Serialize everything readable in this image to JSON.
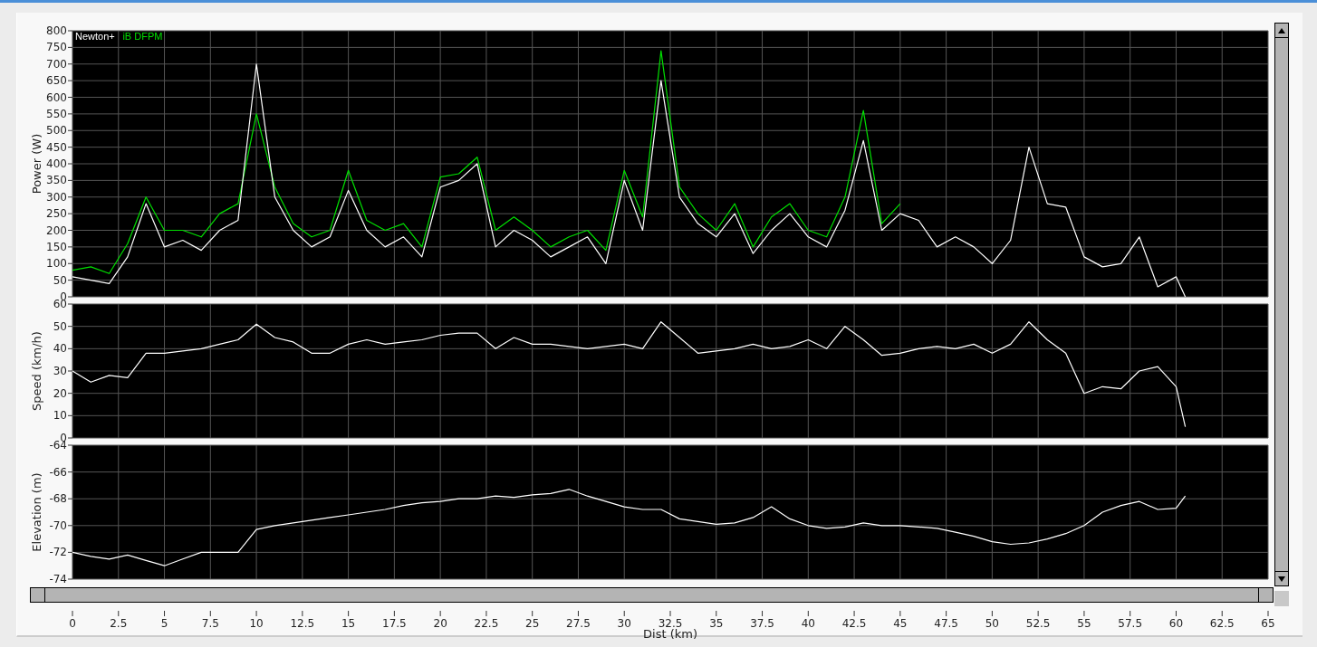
{
  "charts": [
    {
      "chart_data": {
        "type": "line",
        "grid": true,
        "ylabel": "Power (W)",
        "xlim": [
          0,
          65
        ],
        "ylim": [
          0,
          800
        ],
        "yticks": [
          0,
          50,
          100,
          150,
          200,
          250,
          300,
          350,
          400,
          450,
          500,
          550,
          600,
          650,
          700,
          750,
          800
        ],
        "x": [
          0,
          1,
          2,
          3,
          4,
          5,
          6,
          7,
          8,
          9,
          10,
          11,
          12,
          13,
          14,
          15,
          16,
          17,
          18,
          19,
          20,
          21,
          22,
          23,
          24,
          25,
          26,
          27,
          28,
          29,
          30,
          31,
          32,
          33,
          34,
          35,
          36,
          37,
          38,
          39,
          40,
          41,
          42,
          43,
          44,
          45,
          46,
          47,
          48,
          49,
          50,
          51,
          52,
          53,
          54,
          55,
          56,
          57,
          58,
          59,
          60,
          60.5
        ],
        "series": [
          {
            "name": "iB DFPM",
            "color": "#00e000",
            "values": [
              80,
              90,
              70,
              160,
              300,
              200,
              200,
              180,
              250,
              280,
              550,
              330,
              220,
              180,
              200,
              380,
              230,
              200,
              220,
              150,
              360,
              370,
              420,
              200,
              240,
              200,
              150,
              180,
              200,
              140,
              380,
              240,
              740,
              330,
              250,
              200,
              280,
              150,
              240,
              280,
              200,
              180,
              300,
              560,
              220,
              280,
              null,
              null,
              null,
              null,
              null,
              null,
              null,
              null,
              null,
              null,
              null,
              null,
              null,
              null,
              null,
              null
            ]
          },
          {
            "name": "Newton+",
            "color": "#ffffff",
            "values": [
              60,
              50,
              40,
              120,
              280,
              150,
              170,
              140,
              200,
              230,
              700,
              300,
              200,
              150,
              180,
              320,
              200,
              150,
              180,
              120,
              330,
              350,
              400,
              150,
              200,
              170,
              120,
              150,
              180,
              100,
              350,
              200,
              650,
              300,
              220,
              180,
              250,
              130,
              200,
              250,
              180,
              150,
              260,
              470,
              200,
              250,
              230,
              150,
              180,
              150,
              100,
              170,
              450,
              280,
              270,
              120,
              90,
              100,
              180,
              30,
              60,
              0
            ]
          }
        ]
      }
    },
    {
      "chart_data": {
        "type": "line",
        "grid": true,
        "ylabel": "Speed (km/h)",
        "xlim": [
          0,
          65
        ],
        "ylim": [
          0,
          60
        ],
        "yticks": [
          0,
          10,
          20,
          30,
          40,
          50,
          60
        ],
        "x": [
          0,
          1,
          2,
          3,
          4,
          5,
          6,
          7,
          8,
          9,
          10,
          11,
          12,
          13,
          14,
          15,
          16,
          17,
          18,
          19,
          20,
          21,
          22,
          23,
          24,
          25,
          26,
          27,
          28,
          29,
          30,
          31,
          32,
          33,
          34,
          35,
          36,
          37,
          38,
          39,
          40,
          41,
          42,
          43,
          44,
          45,
          46,
          47,
          48,
          49,
          50,
          51,
          52,
          53,
          54,
          55,
          56,
          57,
          58,
          59,
          60,
          60.5
        ],
        "series": [
          {
            "color": "#ffffff",
            "values": [
              30,
              25,
              28,
              27,
              38,
              38,
              39,
              40,
              42,
              44,
              51,
              45,
              43,
              38,
              38,
              42,
              44,
              42,
              43,
              44,
              46,
              47,
              47,
              40,
              45,
              42,
              42,
              41,
              40,
              41,
              42,
              40,
              52,
              45,
              38,
              39,
              40,
              42,
              40,
              41,
              44,
              40,
              50,
              44,
              37,
              38,
              40,
              41,
              40,
              42,
              38,
              42,
              52,
              44,
              38,
              20,
              23,
              22,
              30,
              32,
              23,
              5
            ]
          }
        ]
      }
    },
    {
      "chart_data": {
        "type": "line",
        "grid": true,
        "ylabel": "Elevation (m)",
        "xlabel": "Dist (km)",
        "xlim": [
          0,
          65
        ],
        "ylim": [
          -74,
          -64
        ],
        "xticks": [
          0,
          2.5,
          5,
          7.5,
          10,
          12.5,
          15,
          17.5,
          20,
          22.5,
          25,
          27.5,
          30,
          32.5,
          35,
          37.5,
          40,
          42.5,
          45,
          47.5,
          50,
          52.5,
          55,
          57.5,
          60,
          62.5,
          65
        ],
        "yticks": [
          -74,
          -72,
          -70,
          -68,
          -66,
          -64
        ],
        "x": [
          0,
          1,
          2,
          3,
          4,
          5,
          6,
          7,
          8,
          9,
          10,
          11,
          12,
          13,
          14,
          15,
          16,
          17,
          18,
          19,
          20,
          21,
          22,
          23,
          24,
          25,
          26,
          27,
          28,
          29,
          30,
          31,
          32,
          33,
          34,
          35,
          36,
          37,
          38,
          39,
          40,
          41,
          42,
          43,
          44,
          45,
          46,
          47,
          48,
          49,
          50,
          51,
          52,
          53,
          54,
          55,
          56,
          57,
          58,
          59,
          60,
          60.5
        ],
        "series": [
          {
            "color": "#ffffff",
            "values": [
              -72,
              -72.3,
              -72.5,
              -72.2,
              -72.6,
              -73,
              -72.5,
              -72,
              -72,
              -72,
              -70.3,
              -70,
              -69.8,
              -69.6,
              -69.4,
              -69.2,
              -69,
              -68.8,
              -68.5,
              -68.3,
              -68.2,
              -68,
              -68,
              -67.8,
              -67.9,
              -67.7,
              -67.6,
              -67.3,
              -67.8,
              -68.2,
              -68.6,
              -68.8,
              -68.8,
              -69.5,
              -69.7,
              -69.9,
              -69.8,
              -69.4,
              -68.6,
              -69.5,
              -70,
              -70.2,
              -70.1,
              -69.8,
              -70,
              -70,
              -70.1,
              -70.2,
              -70.5,
              -70.8,
              -71.2,
              -71.4,
              -71.3,
              -71,
              -70.6,
              -70,
              -69,
              -68.5,
              -68.2,
              -68.8,
              -68.7,
              -67.8
            ]
          }
        ]
      }
    }
  ]
}
